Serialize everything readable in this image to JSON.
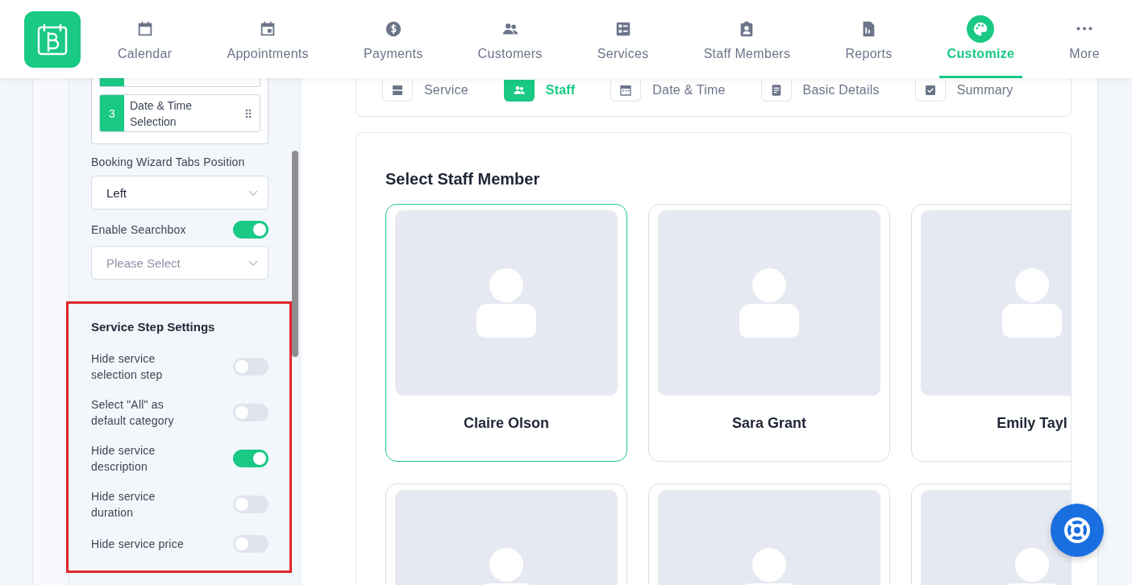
{
  "nav": [
    {
      "label": "Calendar",
      "selected": false
    },
    {
      "label": "Appointments",
      "selected": false
    },
    {
      "label": "Payments",
      "selected": false
    },
    {
      "label": "Customers",
      "selected": false
    },
    {
      "label": "Services",
      "selected": false
    },
    {
      "label": "Staff Members",
      "selected": false
    },
    {
      "label": "Reports",
      "selected": false
    },
    {
      "label": "Customize",
      "selected": true
    },
    {
      "label": "More",
      "selected": false
    }
  ],
  "sidebar": {
    "steps": [
      {
        "number": "3",
        "label": "Date & Time Selection"
      }
    ],
    "tabs_position": {
      "label": "Booking Wizard Tabs Position",
      "value": "Left"
    },
    "searchbox": {
      "label": "Enable Searchbox",
      "on": true,
      "placeholder": "Please Select"
    },
    "service_step_settings": {
      "title": "Service Step Settings",
      "toggles": [
        {
          "label": "Hide service selection step",
          "on": false
        },
        {
          "label": "Select \"All\" as default category",
          "on": false
        },
        {
          "label": "Hide service description",
          "on": true
        },
        {
          "label": "Hide service duration",
          "on": false
        },
        {
          "label": "Hide service price",
          "on": false
        }
      ]
    }
  },
  "wizard_tabs": [
    {
      "label": "Service",
      "selected": false
    },
    {
      "label": "Staff",
      "selected": true
    },
    {
      "label": "Date & Time",
      "selected": false
    },
    {
      "label": "Basic Details",
      "selected": false
    },
    {
      "label": "Summary",
      "selected": false
    }
  ],
  "staff": {
    "title": "Select Staff Member",
    "members": [
      {
        "name": "Claire Olson",
        "selected": true
      },
      {
        "name": "Sara Grant",
        "selected": false
      },
      {
        "name": "Emily Tayl",
        "selected": false
      },
      {
        "selected": false
      },
      {
        "selected": false
      },
      {
        "selected": false
      }
    ]
  }
}
